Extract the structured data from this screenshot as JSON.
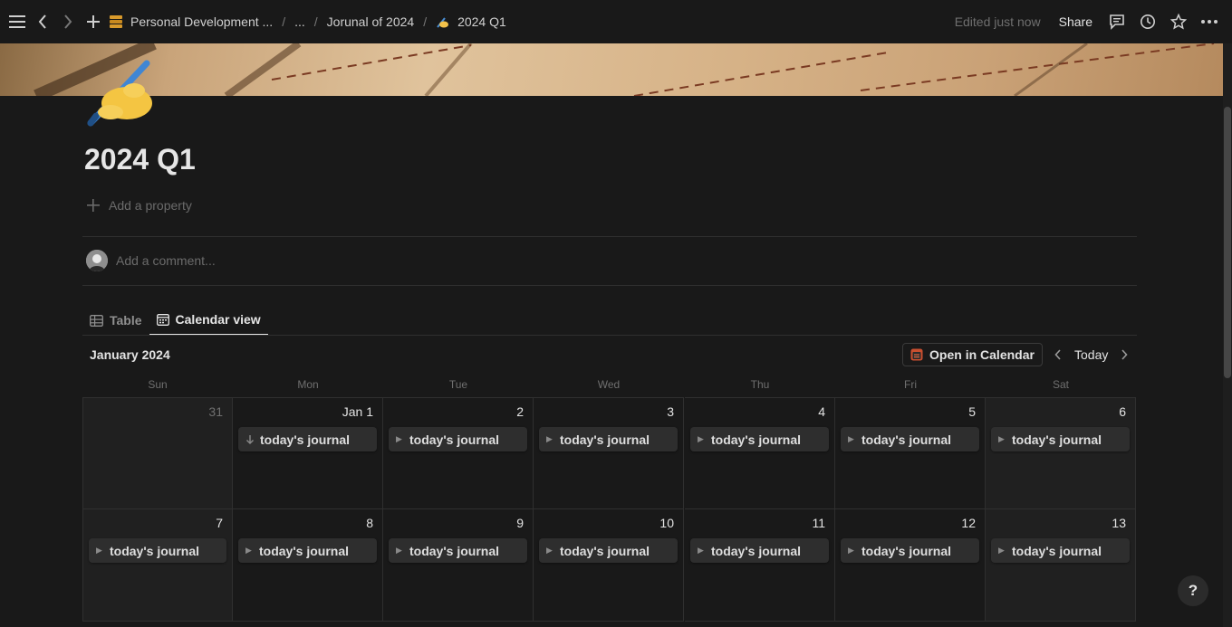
{
  "topbar": {
    "breadcrumbs": [
      {
        "label": "Personal Development ...",
        "icon": "database-icon"
      },
      {
        "label": "..."
      },
      {
        "label": "Jorunal of 2024"
      },
      {
        "label": "2024 Q1",
        "icon": "writing-hand-icon"
      }
    ],
    "edited": "Edited just now",
    "share": "Share"
  },
  "page": {
    "title": "2024 Q1",
    "add_property": "Add a property",
    "add_comment": "Add a comment..."
  },
  "tabs": [
    {
      "label": "Table",
      "icon": "table-icon",
      "active": false
    },
    {
      "label": "Calendar view",
      "icon": "calendar-icon",
      "active": true
    }
  ],
  "calendar": {
    "month": "January 2024",
    "open_in_calendar": "Open in Calendar",
    "today": "Today",
    "weekdays": [
      "Sun",
      "Mon",
      "Tue",
      "Wed",
      "Thu",
      "Fri",
      "Sat"
    ],
    "weeks": [
      [
        {
          "day": "31",
          "event": ""
        },
        {
          "day": "Jan 1",
          "event": "today's journal"
        },
        {
          "day": "2",
          "event": "today's journal"
        },
        {
          "day": "3",
          "event": "today's journal"
        },
        {
          "day": "4",
          "event": "today's journal"
        },
        {
          "day": "5",
          "event": "today's journal"
        },
        {
          "day": "6",
          "event": "today's journal"
        }
      ],
      [
        {
          "day": "7",
          "event": "today's journal"
        },
        {
          "day": "8",
          "event": "today's journal"
        },
        {
          "day": "9",
          "event": "today's journal"
        },
        {
          "day": "10",
          "event": "today's journal"
        },
        {
          "day": "11",
          "event": "today's journal"
        },
        {
          "day": "12",
          "event": "today's journal"
        },
        {
          "day": "13",
          "event": "today's journal"
        }
      ]
    ]
  },
  "help": "?"
}
